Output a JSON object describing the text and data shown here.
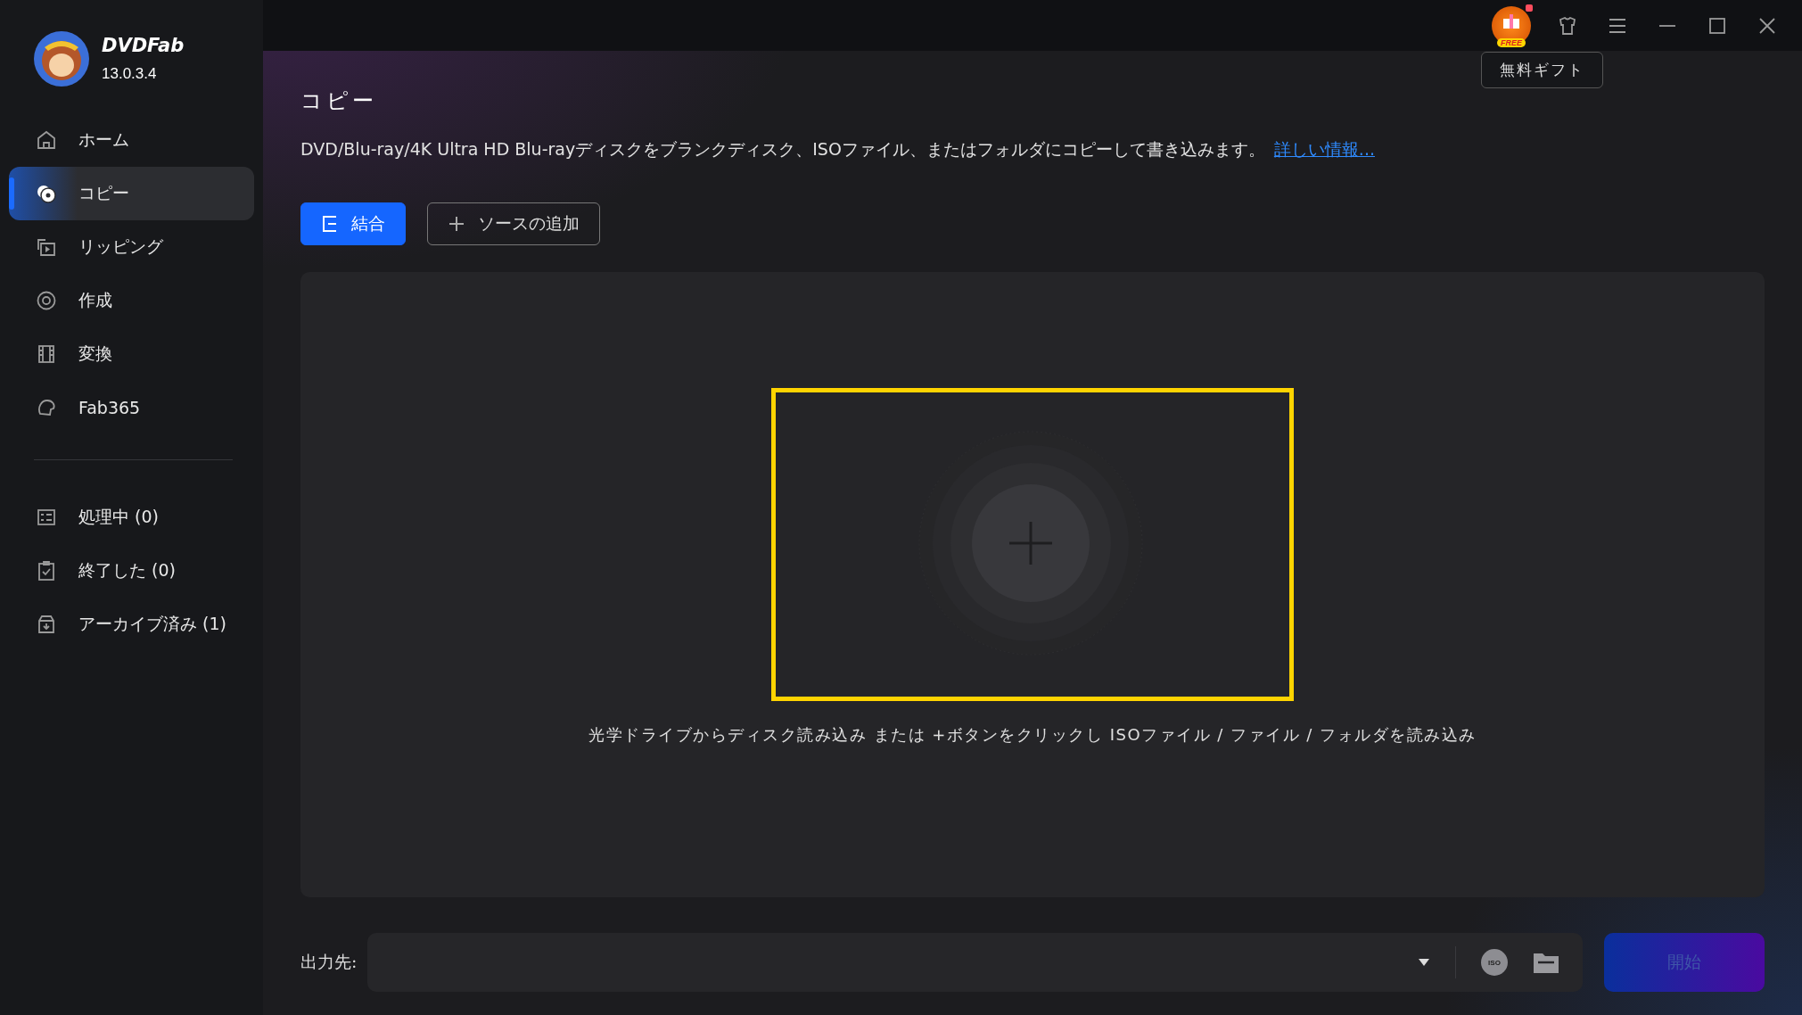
{
  "app": {
    "name": "DVDFab",
    "version": "13.0.3.4"
  },
  "sidebar": {
    "items": [
      {
        "label": "ホーム",
        "selected": false
      },
      {
        "label": "コピー",
        "selected": true
      },
      {
        "label": "リッピング",
        "selected": false
      },
      {
        "label": "作成",
        "selected": false
      },
      {
        "label": "変換",
        "selected": false
      },
      {
        "label": "Fab365",
        "selected": false
      }
    ],
    "queue": [
      {
        "label": "処理中 (0)",
        "selected": false
      },
      {
        "label": "終了した (0)",
        "selected": false
      },
      {
        "label": "アーカイブ済み (1)",
        "selected": false
      }
    ]
  },
  "title_bar": {
    "gift_badge": "FREE",
    "tooltip": "無料ギフト"
  },
  "page": {
    "title": "コピー",
    "description": "DVD/Blu-ray/4K Ultra HD Blu-rayディスクをブランクディスク、ISOファイル、またはフォルダにコピーして書き込みます。",
    "link": "詳しい情報...",
    "buttons": [
      {
        "label": "結合",
        "kind": "primary"
      },
      {
        "label": "ソースの追加",
        "kind": "outline"
      }
    ],
    "drop_hint": "光学ドライブからディスク読み込み または +ボタンをクリックし ISOファイル / ファイル / フォルダを読み込み",
    "highlighted": true
  },
  "output": {
    "label": "出力先:",
    "iso_badge": "ISO",
    "start": "開始",
    "start_disabled": true
  }
}
